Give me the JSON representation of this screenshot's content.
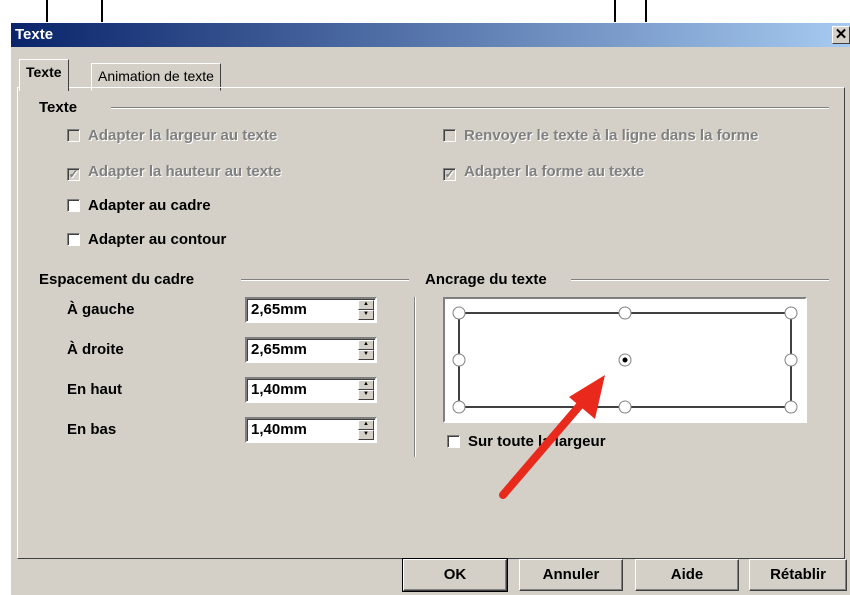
{
  "window": {
    "title": "Texte",
    "close_glyph": "✕"
  },
  "tabs": [
    {
      "label": "Texte",
      "active": true
    },
    {
      "label": "Animation de texte",
      "active": false
    }
  ],
  "texte_group": {
    "title": "Texte",
    "options": [
      {
        "label": "Adapter la largeur au texte",
        "checked": false,
        "enabled": false
      },
      {
        "label": "Renvoyer le texte à la ligne dans la forme",
        "checked": false,
        "enabled": false
      },
      {
        "label": "Adapter la hauteur au texte",
        "checked": true,
        "enabled": false
      },
      {
        "label": "Adapter la forme au texte",
        "checked": true,
        "enabled": false
      },
      {
        "label": "Adapter au cadre",
        "checked": false,
        "enabled": true
      },
      {
        "label": "Adapter au contour",
        "checked": false,
        "enabled": true
      }
    ]
  },
  "spacing_group": {
    "title": "Espacement du cadre",
    "fields": [
      {
        "label": "À gauche",
        "value": "2,65mm"
      },
      {
        "label": "À droite",
        "value": "2,65mm"
      },
      {
        "label": "En haut",
        "value": "1,40mm"
      },
      {
        "label": "En bas",
        "value": "1,40mm"
      }
    ]
  },
  "anchor_group": {
    "title": "Ancrage du texte",
    "selected": "center",
    "full_width_label": "Sur toute la largeur",
    "full_width_checked": false
  },
  "buttons": {
    "ok": "OK",
    "cancel": "Annuler",
    "help": "Aide",
    "reset": "Rétablir"
  },
  "annotation": {
    "arrow_color": "#e8291c"
  },
  "colors": {
    "title_start": "#0a246a",
    "title_end": "#a6caf0",
    "face": "#d4d0c8"
  }
}
